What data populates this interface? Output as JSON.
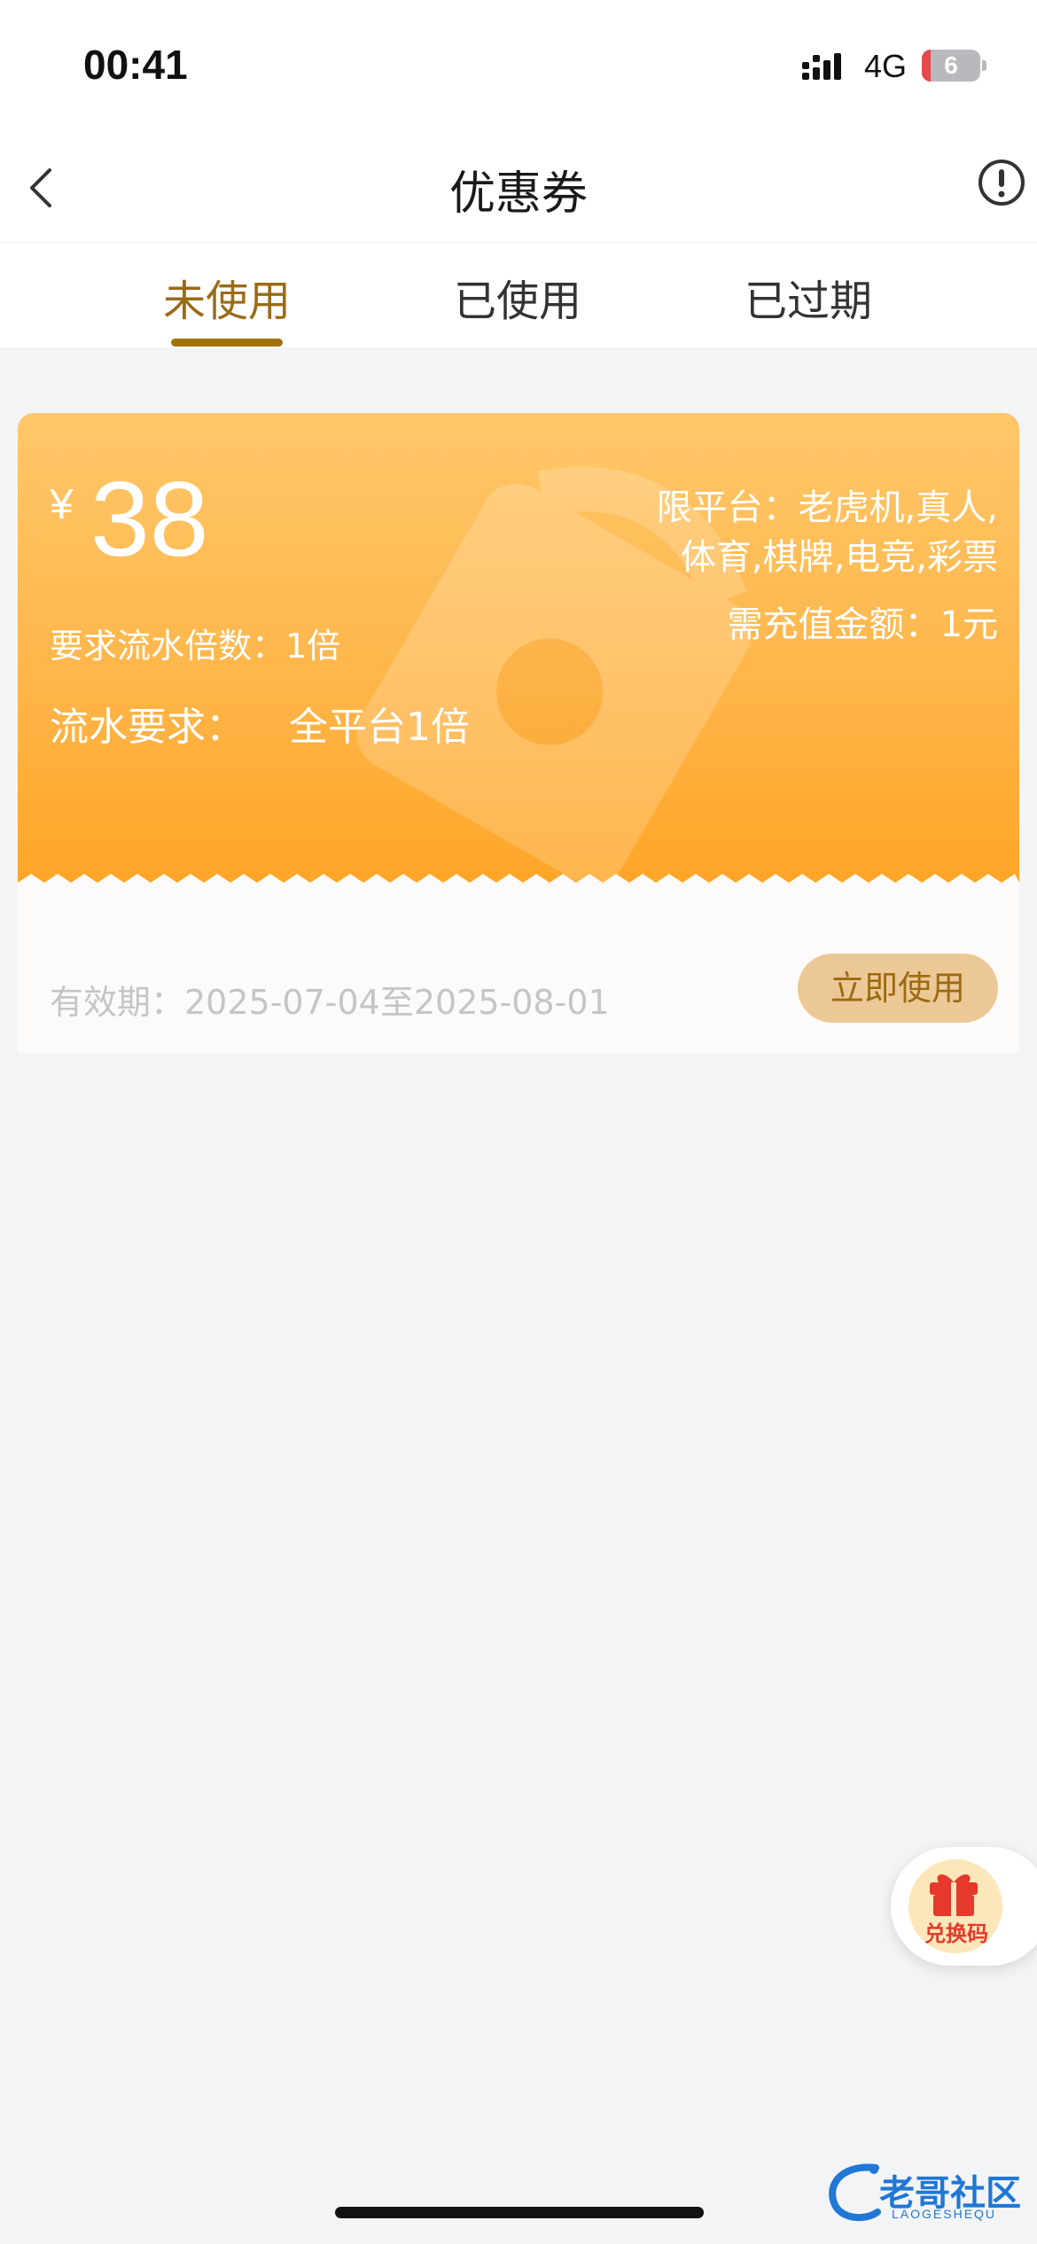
{
  "status_bar": {
    "time": "00:41",
    "network": "4G",
    "battery": "6"
  },
  "nav": {
    "title": "优惠券"
  },
  "tabs": [
    {
      "label": "未使用",
      "active": true
    },
    {
      "label": "已使用",
      "active": false
    },
    {
      "label": "已过期",
      "active": false
    }
  ],
  "coupon": {
    "currency": "¥",
    "amount": "38",
    "wager_multiple": "要求流水倍数：1倍",
    "flow_label": "流水要求：",
    "flow_value": "全平台1倍",
    "platform_line1": "限平台：老虎机,真人,",
    "platform_line2": "体育,棋牌,电竞,彩票",
    "recharge": "需充值金额：1元",
    "validity": "有效期：2025-07-04至2025-08-01",
    "use_button": "立即使用"
  },
  "redeem_button": {
    "label": "兑换码"
  },
  "watermark_logo": {
    "text": "老哥社区",
    "sub": "LAOGESHEQU"
  },
  "colors": {
    "accent": "#a0730f",
    "coupon_top": "#ffc76a",
    "coupon_bottom": "#ffa526",
    "button_bg": "#ecc896"
  }
}
